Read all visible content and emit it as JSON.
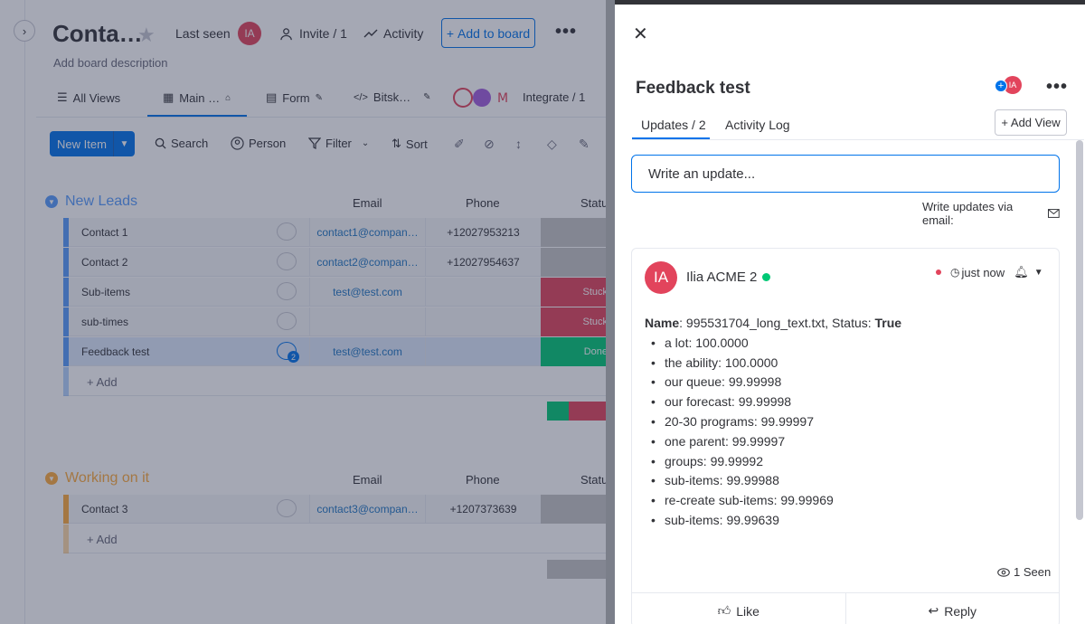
{
  "board": {
    "title": "Conta…",
    "last_seen_label": "Last seen",
    "avatar_initials": "IA",
    "invite_label": "Invite / 1",
    "activity_label": "Activity",
    "add_to_board_label": "Add to board",
    "description_placeholder": "Add board description",
    "views": [
      {
        "label": "All Views"
      },
      {
        "label": "Main …"
      },
      {
        "label": "Form"
      },
      {
        "label": "Bitsk…"
      },
      {
        "label": "Integrate / 1"
      }
    ],
    "toolbar": {
      "new_item_label": "New Item",
      "search_label": "Search",
      "person_label": "Person",
      "filter_label": "Filter",
      "sort_label": "Sort"
    },
    "groups": [
      {
        "title": "New Leads",
        "color": "#579bfc",
        "columns": {
          "email": "Email",
          "phone": "Phone",
          "status": "Statu"
        },
        "rows": [
          {
            "name": "Contact 1",
            "email": "contact1@compan…",
            "phone": "+12027953213",
            "status": "",
            "status_color": "#c4c4c4"
          },
          {
            "name": "Contact 2",
            "email": "contact2@compan…",
            "phone": "+12027954637",
            "status": "",
            "status_color": "#c4c4c4"
          },
          {
            "name": "Sub-items",
            "email": "test@test.com",
            "phone": "",
            "status": "Stuck",
            "status_color": "#e2445c"
          },
          {
            "name": "sub-times",
            "email": "",
            "phone": "",
            "status": "Stuck",
            "status_color": "#e2445c"
          },
          {
            "name": "Feedback test",
            "email": "test@test.com",
            "phone": "",
            "status": "Done",
            "status_color": "#00c875",
            "update_count": "2"
          }
        ],
        "add_label": "+ Add"
      },
      {
        "title": "Working on it",
        "color": "#fdab3d",
        "columns": {
          "email": "Email",
          "phone": "Phone",
          "status": "Statu"
        },
        "rows": [
          {
            "name": "Contact 3",
            "email": "contact3@compan…",
            "phone": "+1207373639",
            "status": "",
            "status_color": "#c4c4c4"
          }
        ],
        "add_label": "+ Add"
      }
    ]
  },
  "panel": {
    "item_title": "Feedback test",
    "avatar_initials": "IA",
    "tabs": {
      "updates": "Updates / 2",
      "activity_log": "Activity Log"
    },
    "add_view_label": "+ Add View",
    "update_placeholder": "Write an update...",
    "email_hint": "Write updates via email:",
    "post": {
      "avatar_initials": "IA",
      "author": "Ilia ACME 2",
      "time": "just now",
      "name_label": "Name",
      "name_value": ": 995531704_long_text.txt, Status: ",
      "status_value": "True",
      "items": [
        "a lot: 100.0000",
        "the ability: 100.0000",
        "our queue: 99.99998",
        "our forecast: 99.99998",
        "20-30 programs: 99.99997",
        "one parent: 99.99997",
        "groups: 99.99992",
        "sub-items: 99.99988",
        "re-create sub-items: 99.99969",
        "sub-items: 99.99639"
      ],
      "seen_label": "1 Seen",
      "like_label": "Like",
      "reply_label": "Reply"
    }
  },
  "colors": {
    "accent": "#0073ea",
    "avatar": "#e2445c",
    "online": "#00c875"
  }
}
